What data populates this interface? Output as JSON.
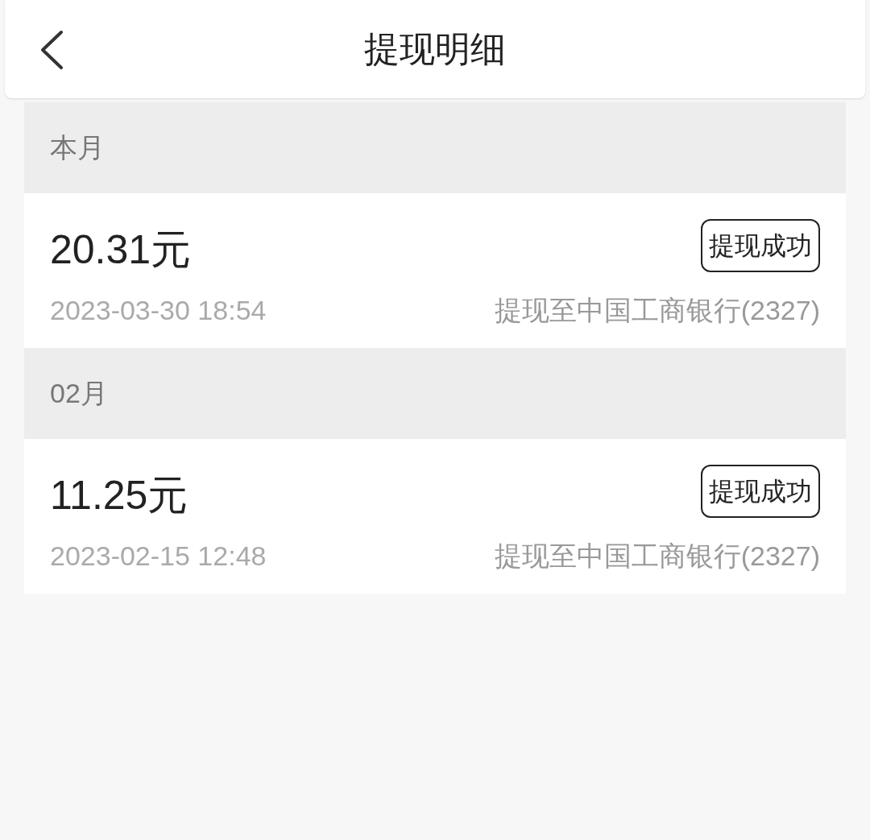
{
  "header": {
    "title": "提现明细"
  },
  "sections": [
    {
      "label": "本月",
      "records": [
        {
          "amount": "20.31元",
          "status": "提现成功",
          "time": "2023-03-30 18:54",
          "destination": "提现至中国工商银行(2327)"
        }
      ]
    },
    {
      "label": "02月",
      "records": [
        {
          "amount": "11.25元",
          "status": "提现成功",
          "time": "2023-02-15 12:48",
          "destination": "提现至中国工商银行(2327)"
        }
      ]
    }
  ]
}
